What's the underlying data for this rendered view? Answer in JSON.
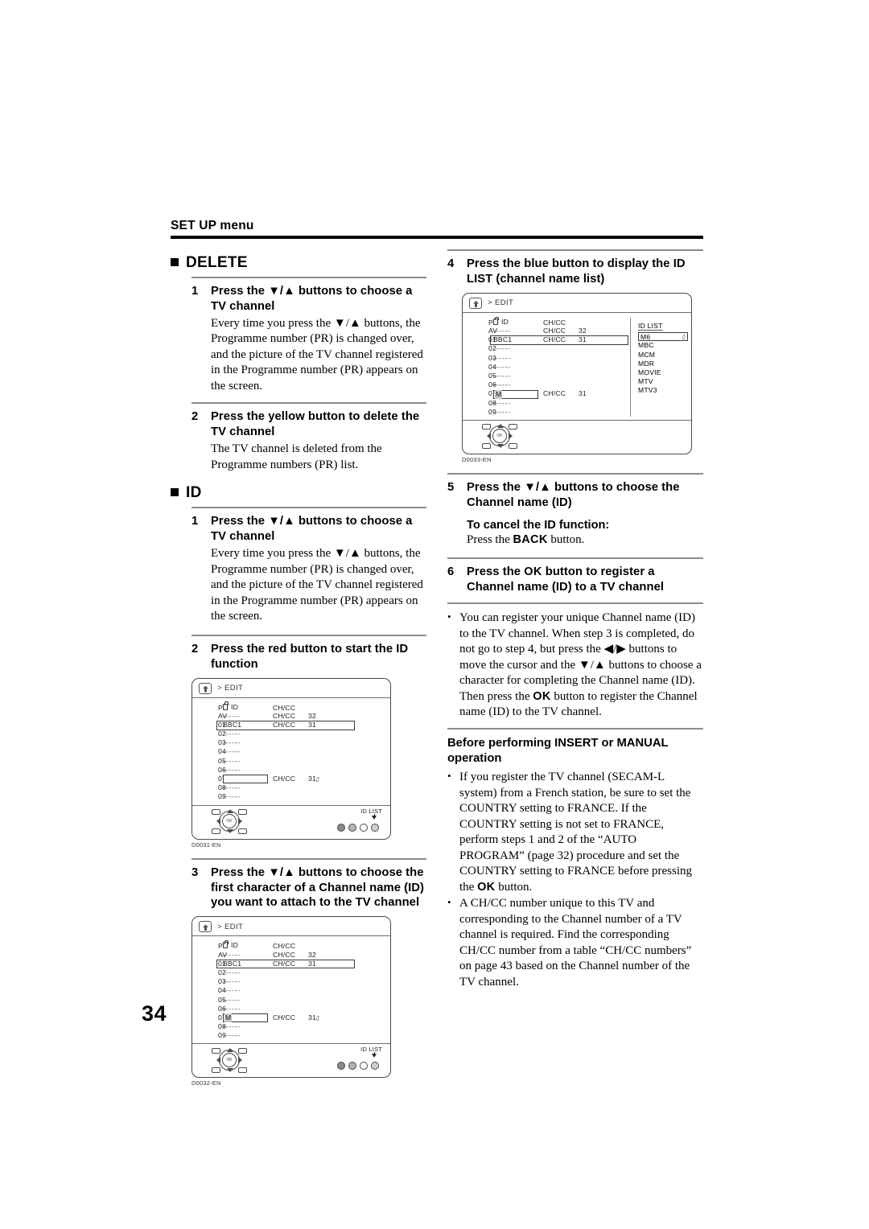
{
  "page": {
    "running_header": "SET UP menu",
    "page_number": "34"
  },
  "left_column": {
    "section_delete": {
      "heading": "DELETE",
      "steps": [
        {
          "num": "1",
          "title": "Press the ▼/▲ buttons to choose a TV channel",
          "body": "Every time you press the ▼/▲ buttons, the Programme number (PR) is changed over, and the picture of the TV channel registered in the Programme number (PR) appears on the screen."
        },
        {
          "num": "2",
          "title": "Press the yellow button to delete the TV channel",
          "body": "The TV channel is deleted from the Programme numbers (PR) list."
        }
      ]
    },
    "section_id": {
      "heading": "ID",
      "steps": [
        {
          "num": "1",
          "title": "Press the ▼/▲ buttons to choose a TV channel",
          "body": "Every time you press the ▼/▲ buttons, the Programme number (PR) is changed over, and the picture of the TV channel registered in the Programme number (PR) appears on the screen."
        },
        {
          "num": "2",
          "title": "Press the red button to start the ID function",
          "body": ""
        },
        {
          "num": "3",
          "title": "Press the ▼/▲ buttons to choose the first character of a Channel name (ID) you want to attach to the TV channel",
          "body": ""
        }
      ]
    }
  },
  "right_column": {
    "steps": [
      {
        "num": "4",
        "title": "Press the blue button to display the ID LIST (channel name list)"
      },
      {
        "num": "5",
        "title": "Press the ▼/▲ buttons to choose the Channel name (ID)",
        "subhead": "To cancel the ID function:",
        "sub_body_pre": "Press the ",
        "sub_key": "BACK",
        "sub_body_post": " button."
      },
      {
        "num": "6",
        "title_pre": "Press the ",
        "title_key": "OK",
        "title_post": " button to register a Channel name (ID) to a TV channel"
      }
    ],
    "register_note": {
      "text_a": "You can register your unique Channel name (ID) to the TV channel. When step 3 is completed, do not go to step 4, but press the ◀/▶ buttons to move the cursor and the ▼/▲ buttons to choose a character for completing the Channel name (ID). Then press the ",
      "key": "OK",
      "text_b": " button to register the Channel name (ID) to the TV channel."
    },
    "before_block": {
      "heading": "Before performing INSERT or MANUAL operation",
      "bullets": [
        {
          "text_a": "If you register the TV channel (SECAM-L system) from a French station, be sure to set the COUNTRY setting to FRANCE. If the COUNTRY setting is not set to FRANCE, perform steps 1 and 2 of the “AUTO PROGRAM” (page 32) procedure and set the COUNTRY setting to FRANCE before pressing the ",
          "key": "OK",
          "text_b": " button."
        },
        {
          "text_a": "A CH/CC number unique to this TV and corresponding to the Channel number of a TV channel is required. Find the corresponding CH/CC number from a table “CH/CC numbers” on page 43 based on the Channel number of the TV channel.",
          "key": "",
          "text_b": ""
        }
      ]
    }
  },
  "figures": {
    "fig1": {
      "code": "D0031-EN",
      "title": "> EDIT",
      "headers": {
        "pr": "PR",
        "id": "ID",
        "chcc": "CH/CC"
      },
      "rows": [
        {
          "pr": "AV",
          "id": "------",
          "ch": "CH/CC",
          "num": "32",
          "highlight": false,
          "box": false
        },
        {
          "pr": "01",
          "id": "BBC1",
          "ch": "CH/CC",
          "num": "31",
          "highlight": true,
          "box": false
        },
        {
          "pr": "02",
          "id": "------",
          "ch": "",
          "num": "",
          "highlight": false,
          "box": false
        },
        {
          "pr": "03",
          "id": "------",
          "ch": "",
          "num": "",
          "highlight": false,
          "box": false
        },
        {
          "pr": "04",
          "id": "------",
          "ch": "",
          "num": "",
          "highlight": false,
          "box": false
        },
        {
          "pr": "05",
          "id": "------",
          "ch": "",
          "num": "",
          "highlight": false,
          "box": false
        },
        {
          "pr": "06",
          "id": "------",
          "ch": "",
          "num": "",
          "highlight": false,
          "box": false
        },
        {
          "pr": "07",
          "id": "",
          "ch": "CH/CC",
          "num": "31",
          "highlight": false,
          "box": true,
          "box_char": ""
        },
        {
          "pr": "08",
          "id": "------",
          "ch": "",
          "num": "",
          "highlight": false,
          "box": false
        },
        {
          "pr": "09",
          "id": "------",
          "ch": "",
          "num": "",
          "highlight": false,
          "box": false
        }
      ],
      "colorkey_label": "ID LIST",
      "ok_label": "OK",
      "has_idlist": false,
      "has_footer": true
    },
    "fig2": {
      "code": "D0032-EN",
      "title": "> EDIT",
      "headers": {
        "pr": "PR",
        "id": "ID",
        "chcc": "CH/CC"
      },
      "rows": [
        {
          "pr": "AV",
          "id": "------",
          "ch": "CH/CC",
          "num": "32",
          "highlight": false,
          "box": false
        },
        {
          "pr": "01",
          "id": "BBC1",
          "ch": "CH/CC",
          "num": "31",
          "highlight": true,
          "box": false
        },
        {
          "pr": "02",
          "id": "------",
          "ch": "",
          "num": "",
          "highlight": false,
          "box": false
        },
        {
          "pr": "03",
          "id": "------",
          "ch": "",
          "num": "",
          "highlight": false,
          "box": false
        },
        {
          "pr": "04",
          "id": "------",
          "ch": "",
          "num": "",
          "highlight": false,
          "box": false
        },
        {
          "pr": "05",
          "id": "------",
          "ch": "",
          "num": "",
          "highlight": false,
          "box": false
        },
        {
          "pr": "06",
          "id": "------",
          "ch": "",
          "num": "",
          "highlight": false,
          "box": false
        },
        {
          "pr": "07",
          "id": "",
          "ch": "CH/CC",
          "num": "31",
          "highlight": false,
          "box": true,
          "box_char": "M"
        },
        {
          "pr": "08",
          "id": "------",
          "ch": "",
          "num": "",
          "highlight": false,
          "box": false
        },
        {
          "pr": "09",
          "id": "------",
          "ch": "",
          "num": "",
          "highlight": false,
          "box": false
        }
      ],
      "colorkey_label": "ID LIST",
      "ok_label": "OK",
      "has_idlist": false,
      "has_footer": true
    },
    "fig3": {
      "code": "D0033-EN",
      "title": "> EDIT",
      "headers": {
        "pr": "PR",
        "id": "ID",
        "chcc": "CH/CC"
      },
      "rows": [
        {
          "pr": "AV",
          "id": "------",
          "ch": "CH/CC",
          "num": "32",
          "highlight": false,
          "box": false
        },
        {
          "pr": "01",
          "id": "BBC1",
          "ch": "CH/CC",
          "num": "31",
          "highlight": true,
          "box": false
        },
        {
          "pr": "02",
          "id": "------",
          "ch": "",
          "num": "",
          "highlight": false,
          "box": false
        },
        {
          "pr": "03",
          "id": "------",
          "ch": "",
          "num": "",
          "highlight": false,
          "box": false
        },
        {
          "pr": "04",
          "id": "------",
          "ch": "",
          "num": "",
          "highlight": false,
          "box": false
        },
        {
          "pr": "05",
          "id": "------",
          "ch": "",
          "num": "",
          "highlight": false,
          "box": false
        },
        {
          "pr": "06",
          "id": "------",
          "ch": "",
          "num": "",
          "highlight": false,
          "box": false
        },
        {
          "pr": "07",
          "id": "",
          "ch": "CH/CC",
          "num": "31",
          "highlight": false,
          "box": true,
          "box_char": "M"
        },
        {
          "pr": "08",
          "id": "------",
          "ch": "",
          "num": "",
          "highlight": false,
          "box": false
        },
        {
          "pr": "09",
          "id": "------",
          "ch": "",
          "num": "",
          "highlight": false,
          "box": false
        }
      ],
      "idlist_title": "ID LIST",
      "idlist_items": [
        "M6",
        "MBC",
        "MCM",
        "MDR",
        "MOVIE",
        "MTV",
        "MTV3"
      ],
      "idlist_selected": "M6",
      "ok_label": "OK",
      "has_idlist": true,
      "has_footer": true
    }
  }
}
